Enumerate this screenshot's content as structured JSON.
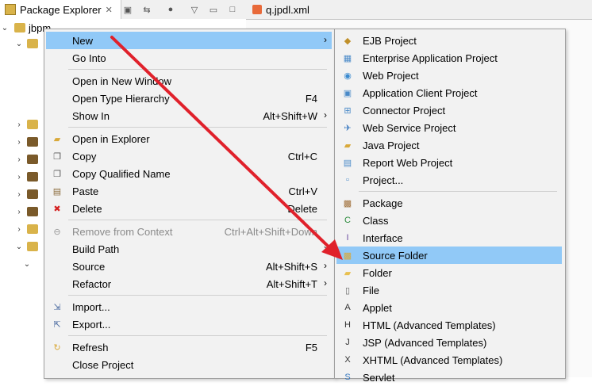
{
  "tabs": {
    "package_explorer": "Package Explorer",
    "editor": "q.jpdl.xml"
  },
  "tree": {
    "root_label": "jbpm"
  },
  "context_menu": [
    {
      "label": "New",
      "shortcut": "",
      "submenu": true,
      "highlighted": true,
      "disabled": false,
      "icon": "blank"
    },
    {
      "label": "Go Into",
      "shortcut": "",
      "submenu": false,
      "highlighted": false,
      "disabled": false,
      "icon": "blank",
      "sep_after": true
    },
    {
      "label": "Open in New Window",
      "shortcut": "",
      "submenu": false,
      "highlighted": false,
      "disabled": false,
      "icon": "blank"
    },
    {
      "label": "Open Type Hierarchy",
      "shortcut": "F4",
      "submenu": false,
      "highlighted": false,
      "disabled": false,
      "icon": "blank"
    },
    {
      "label": "Show In",
      "shortcut": "Alt+Shift+W",
      "submenu": true,
      "highlighted": false,
      "disabled": false,
      "icon": "blank",
      "sep_after": true
    },
    {
      "label": "Open in Explorer",
      "shortcut": "",
      "submenu": false,
      "highlighted": false,
      "disabled": false,
      "icon": "folder-open-icon"
    },
    {
      "label": "Copy",
      "shortcut": "Ctrl+C",
      "submenu": false,
      "highlighted": false,
      "disabled": false,
      "icon": "copy-icon"
    },
    {
      "label": "Copy Qualified Name",
      "shortcut": "",
      "submenu": false,
      "highlighted": false,
      "disabled": false,
      "icon": "copy-qualified-icon"
    },
    {
      "label": "Paste",
      "shortcut": "Ctrl+V",
      "submenu": false,
      "highlighted": false,
      "disabled": false,
      "icon": "paste-icon"
    },
    {
      "label": "Delete",
      "shortcut": "Delete",
      "submenu": false,
      "highlighted": false,
      "disabled": false,
      "icon": "delete-icon",
      "sep_after": true
    },
    {
      "label": "Remove from Context",
      "shortcut": "Ctrl+Alt+Shift+Down",
      "submenu": false,
      "highlighted": false,
      "disabled": true,
      "icon": "remove-context-icon"
    },
    {
      "label": "Build Path",
      "shortcut": "",
      "submenu": true,
      "highlighted": false,
      "disabled": false,
      "icon": "blank"
    },
    {
      "label": "Source",
      "shortcut": "Alt+Shift+S",
      "submenu": true,
      "highlighted": false,
      "disabled": false,
      "icon": "blank"
    },
    {
      "label": "Refactor",
      "shortcut": "Alt+Shift+T",
      "submenu": true,
      "highlighted": false,
      "disabled": false,
      "icon": "blank",
      "sep_after": true
    },
    {
      "label": "Import...",
      "shortcut": "",
      "submenu": false,
      "highlighted": false,
      "disabled": false,
      "icon": "import-icon"
    },
    {
      "label": "Export...",
      "shortcut": "",
      "submenu": false,
      "highlighted": false,
      "disabled": false,
      "icon": "export-icon",
      "sep_after": true
    },
    {
      "label": "Refresh",
      "shortcut": "F5",
      "submenu": false,
      "highlighted": false,
      "disabled": false,
      "icon": "refresh-icon"
    },
    {
      "label": "Close Project",
      "shortcut": "",
      "submenu": false,
      "highlighted": false,
      "disabled": false,
      "icon": "blank"
    }
  ],
  "submenu": [
    {
      "label": "EJB Project",
      "icon": "ejb-project-icon",
      "highlighted": false
    },
    {
      "label": "Enterprise Application Project",
      "icon": "enterprise-app-icon",
      "highlighted": false
    },
    {
      "label": "Web Project",
      "icon": "web-project-icon",
      "highlighted": false
    },
    {
      "label": "Application Client Project",
      "icon": "app-client-icon",
      "highlighted": false
    },
    {
      "label": "Connector Project",
      "icon": "connector-icon",
      "highlighted": false
    },
    {
      "label": "Web Service Project",
      "icon": "web-service-icon",
      "highlighted": false
    },
    {
      "label": "Java Project",
      "icon": "java-project-icon",
      "highlighted": false
    },
    {
      "label": "Report Web Project",
      "icon": "report-web-icon",
      "highlighted": false
    },
    {
      "label": "Project...",
      "icon": "project-icon",
      "highlighted": false,
      "sep_after": true
    },
    {
      "label": "Package",
      "icon": "package-icon",
      "highlighted": false
    },
    {
      "label": "Class",
      "icon": "class-icon",
      "highlighted": false
    },
    {
      "label": "Interface",
      "icon": "interface-icon",
      "highlighted": false
    },
    {
      "label": "Source Folder",
      "icon": "source-folder-icon",
      "highlighted": true
    },
    {
      "label": "Folder",
      "icon": "folder-icon",
      "highlighted": false
    },
    {
      "label": "File",
      "icon": "file-icon",
      "highlighted": false
    },
    {
      "label": "Applet",
      "icon": "applet-icon",
      "highlighted": false
    },
    {
      "label": "HTML (Advanced Templates)",
      "icon": "html-icon",
      "highlighted": false
    },
    {
      "label": "JSP (Advanced Templates)",
      "icon": "jsp-icon",
      "highlighted": false
    },
    {
      "label": "XHTML (Advanced Templates)",
      "icon": "xhtml-icon",
      "highlighted": false
    },
    {
      "label": "Servlet",
      "icon": "servlet-icon",
      "highlighted": false
    }
  ],
  "colors": {
    "highlight": "#91c9f7",
    "arrow": "#e0212b",
    "menu_bg": "#f2f2f2"
  }
}
